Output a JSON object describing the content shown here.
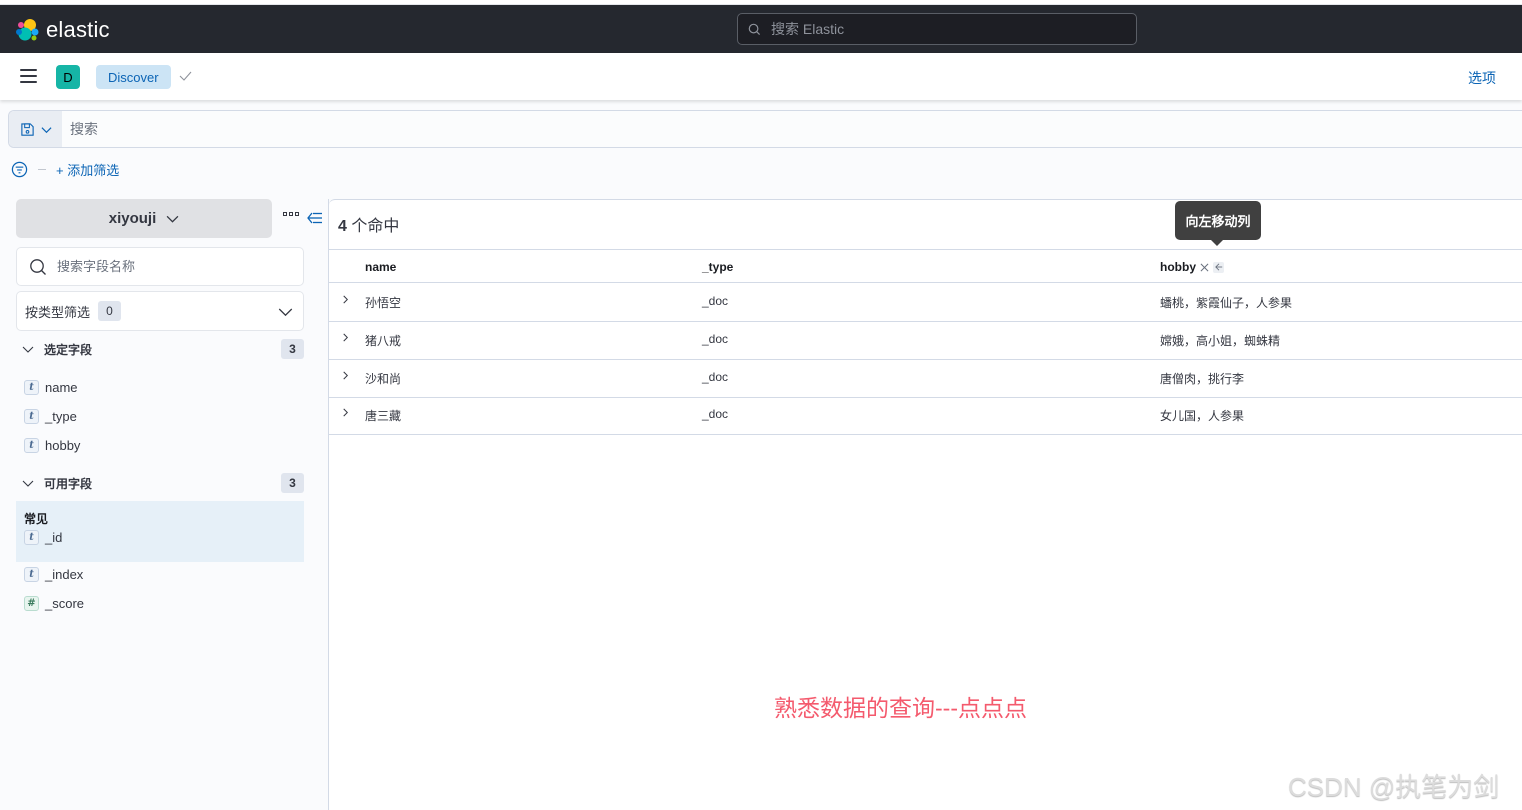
{
  "app": {
    "brand": "elastic",
    "global_search_placeholder": "搜索 Elastic",
    "space_initial": "D",
    "breadcrumb": "Discover",
    "options_label": "选项",
    "more_label": "⋮"
  },
  "query": {
    "placeholder": "搜索",
    "value": "",
    "add_filter_label": "+ 添加筛选"
  },
  "sidebar": {
    "index_pattern": "xiyouji",
    "field_search_placeholder": "搜索字段名称",
    "type_filter_label": "按类型筛选",
    "type_filter_count": "0",
    "selected_section": {
      "label": "选定字段",
      "count": "3",
      "fields": [
        {
          "name": "name",
          "type_glyph": "t"
        },
        {
          "name": "_type",
          "type_glyph": "t"
        },
        {
          "name": "hobby",
          "type_glyph": "t"
        }
      ]
    },
    "available_section": {
      "label": "可用字段",
      "count": "3",
      "common_label": "常见",
      "common_fields": [
        {
          "name": "_id",
          "type_glyph": "t"
        }
      ],
      "fields": [
        {
          "name": "_index",
          "type_glyph": "t"
        },
        {
          "name": "_score",
          "type_glyph": "#"
        }
      ]
    }
  },
  "results": {
    "hits_count": "4",
    "hits_suffix": " 个命中",
    "columns": [
      "name",
      "_type",
      "hobby"
    ],
    "rows": [
      [
        "孙悟空",
        "_doc",
        "蟠桃，紫霞仙子，人参果"
      ],
      [
        "猪八戒",
        "_doc",
        "嫦娥，高小姐，蜘蛛精"
      ],
      [
        "沙和尚",
        "_doc",
        "唐僧肉，挑行李"
      ],
      [
        "唐三藏",
        "_doc",
        "女儿国，人参果"
      ]
    ],
    "tooltip": "向左移动列"
  },
  "overlay": {
    "annotation": "熟悉数据的查询---点点点",
    "watermark": "CSDN @执笔为剑"
  },
  "colors": {
    "header_dark": "#25282f",
    "link": "#0b64b5",
    "breadcrumb_bg": "#cce4f5",
    "space_avatar": "#16b5a6",
    "annotation": "#f45a6d"
  }
}
